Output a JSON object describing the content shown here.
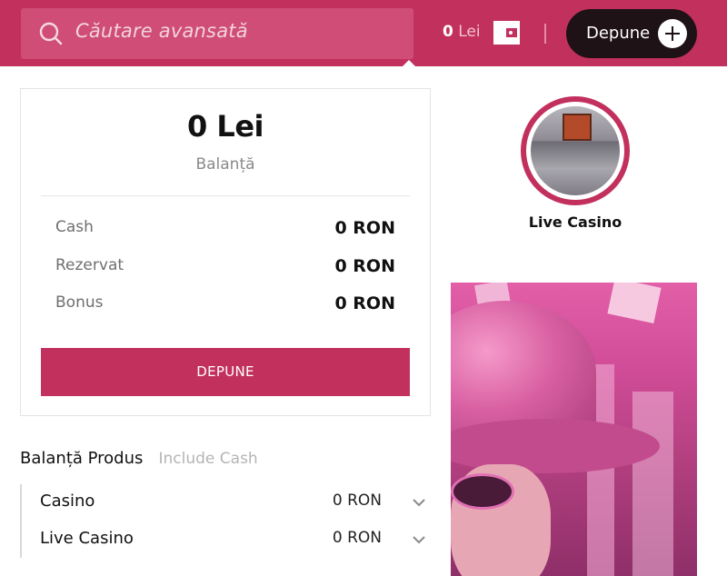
{
  "header": {
    "search_placeholder": "Căutare avansată",
    "balance_amount": "0",
    "balance_currency": "Lei",
    "deposit_label": "Depune"
  },
  "balance_panel": {
    "amount": "0 Lei",
    "caption": "Balanță",
    "rows": [
      {
        "label": "Cash",
        "value": "0 RON"
      },
      {
        "label": "Rezervat",
        "value": "0 RON"
      },
      {
        "label": "Bonus",
        "value": "0 RON"
      }
    ],
    "deposit_button": "DEPUNE"
  },
  "product_balance": {
    "title": "Balanță Produs",
    "subtitle": "Include Cash",
    "items": [
      {
        "label": "Casino",
        "value": "0 RON"
      },
      {
        "label": "Live Casino",
        "value": "0 RON"
      }
    ]
  },
  "categories": {
    "live_casino_label": "Live Casino"
  },
  "colors": {
    "brand": "#c2305e",
    "dark_button": "#1e1216"
  },
  "icons": [
    "search-icon",
    "wallet-icon",
    "plus-icon",
    "chevron-down-icon"
  ]
}
